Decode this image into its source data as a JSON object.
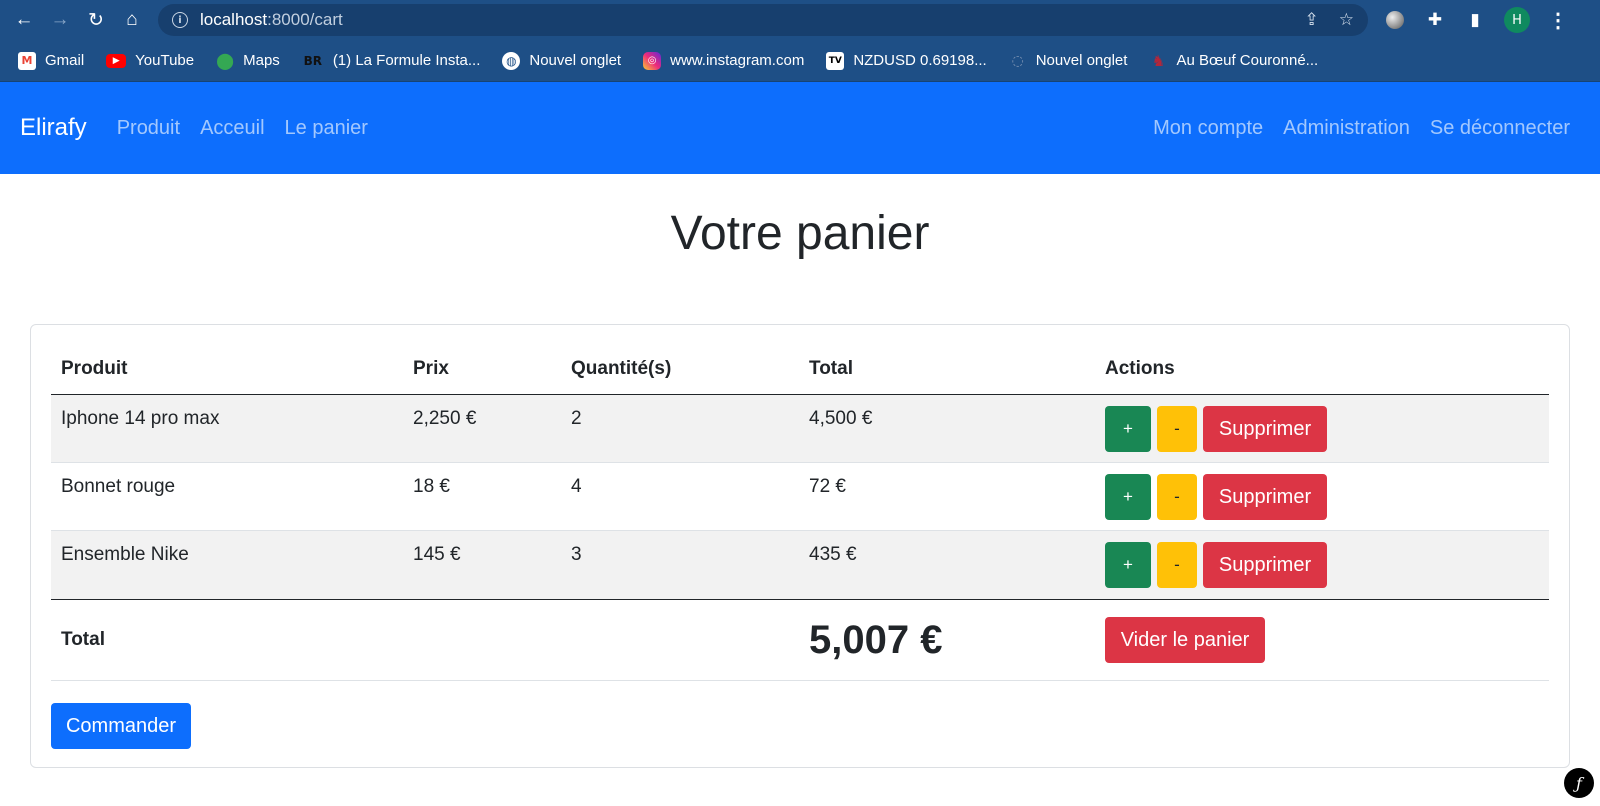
{
  "browser": {
    "url_host": "localhost",
    "url_rest": ":8000/cart",
    "avatar_letter": "H",
    "bookmarks": [
      {
        "icon": "gmail-icon",
        "glyph": "M",
        "label": "Gmail"
      },
      {
        "icon": "youtube-icon",
        "glyph": "▶",
        "label": "YouTube"
      },
      {
        "icon": "maps-icon",
        "glyph": "⬤",
        "label": "Maps"
      },
      {
        "icon": "br-icon",
        "glyph": "BR",
        "label": "(1) La Formule Insta..."
      },
      {
        "icon": "globe-icon",
        "glyph": "◍",
        "label": "Nouvel onglet"
      },
      {
        "icon": "instagram-icon",
        "glyph": "◎",
        "label": "www.instagram.com"
      },
      {
        "icon": "tradingview-icon",
        "glyph": "TV",
        "label": "NZDUSD 0.69198..."
      },
      {
        "icon": "tab-icon",
        "glyph": "◌",
        "label": "Nouvel onglet"
      },
      {
        "icon": "restaurant-icon",
        "glyph": "♞",
        "label": "Au Bœuf Couronné..."
      }
    ]
  },
  "navbar": {
    "brand": "Elirafy",
    "left_links": [
      "Produit",
      "Acceuil",
      "Le panier"
    ],
    "right_links": [
      "Mon compte",
      "Administration",
      "Se déconnecter"
    ]
  },
  "page": {
    "title": "Votre panier"
  },
  "cart": {
    "headers": [
      "Produit",
      "Prix",
      "Quantité(s)",
      "Total",
      "Actions"
    ],
    "rows": [
      {
        "product": "Iphone 14 pro max",
        "price": "2,250 €",
        "qty": "2",
        "total": "4,500 €"
      },
      {
        "product": "Bonnet rouge",
        "price": "18 €",
        "qty": "4",
        "total": "72 €"
      },
      {
        "product": "Ensemble Nike",
        "price": "145 €",
        "qty": "3",
        "total": "435 €"
      }
    ],
    "buttons": {
      "plus": "+",
      "minus": "-",
      "delete": "Supprimer"
    },
    "footer": {
      "label": "Total",
      "grand_total": "5,007 €",
      "empty_button": "Vider le panier"
    },
    "order_button": "Commander"
  },
  "colors": {
    "primary": "#0d6efd",
    "success": "#198754",
    "warning": "#ffc107",
    "danger": "#dc3545"
  }
}
